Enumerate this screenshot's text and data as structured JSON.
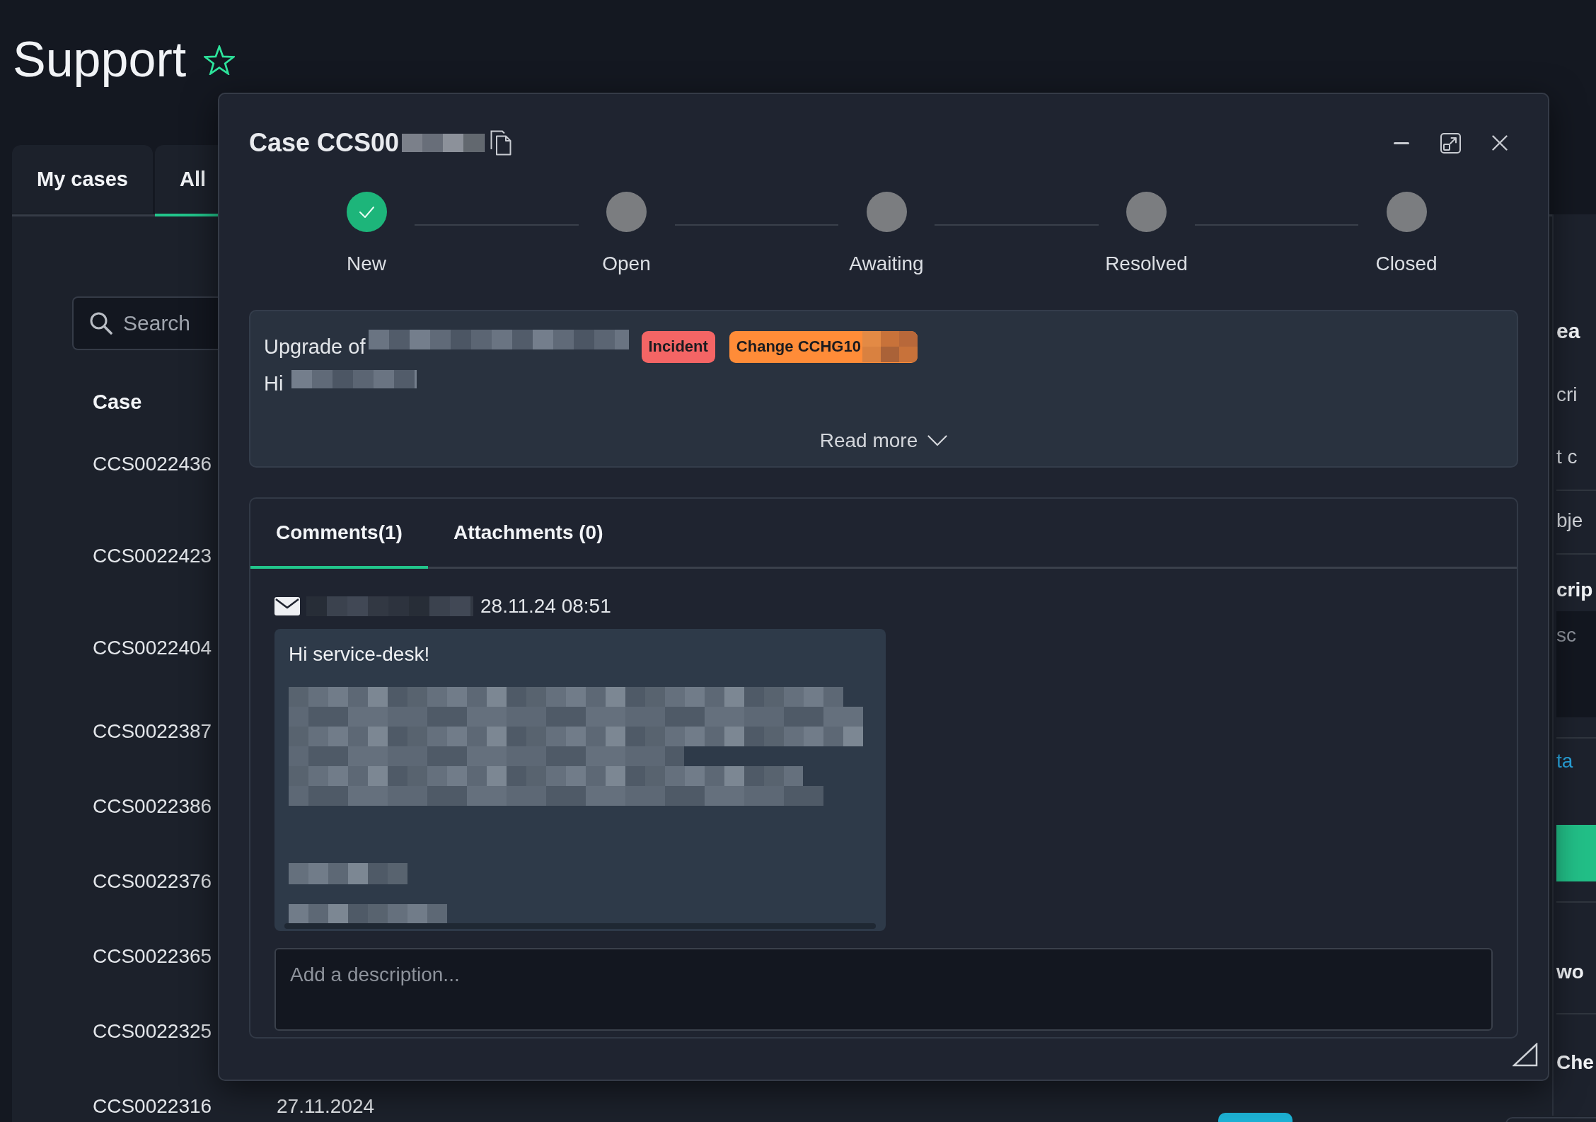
{
  "page": {
    "title": "Support"
  },
  "case_list": {
    "tabs": [
      {
        "label": "My cases",
        "selected": false
      },
      {
        "label": "All",
        "selected": true
      }
    ],
    "search": {
      "placeholder": "Search"
    },
    "columns": [
      "Case"
    ],
    "rows": [
      {
        "case": "CCS0022436"
      },
      {
        "case": "CCS0022423"
      },
      {
        "case": "CCS0022404"
      },
      {
        "case": "CCS0022387"
      },
      {
        "case": "CCS0022386"
      },
      {
        "case": "CCS0022376"
      },
      {
        "case": "CCS0022365"
      },
      {
        "case": "CCS0022325"
      },
      {
        "case": "CCS0022316",
        "column_2": "27.11.2024",
        "badge": {
          "color": "#1db3d6"
        }
      }
    ]
  },
  "details_panel": {
    "sections": [
      {
        "items": [
          {
            "kind": "heading",
            "text": "ea"
          },
          {
            "kind": "text",
            "text": "cri"
          },
          {
            "kind": "text",
            "text": "t c"
          }
        ]
      },
      {
        "items": [
          {
            "kind": "text",
            "text": "bje"
          }
        ]
      },
      {
        "items": [
          {
            "kind": "label",
            "text": "crip"
          },
          {
            "kind": "field",
            "placeholder": "sc"
          }
        ]
      },
      {
        "items": [
          {
            "kind": "link",
            "text": "ta"
          },
          {
            "kind": "button"
          }
        ]
      },
      {
        "items": [
          {
            "kind": "label",
            "text": "wo"
          }
        ]
      },
      {
        "items": [
          {
            "kind": "label",
            "text": "Che"
          }
        ]
      }
    ]
  },
  "case_dialog": {
    "title": "Case CCS00",
    "title_redacted": true,
    "steps": [
      {
        "label": "New",
        "done": true
      },
      {
        "label": "Open",
        "done": false
      },
      {
        "label": "Awaiting",
        "done": false
      },
      {
        "label": "Resolved",
        "done": false
      },
      {
        "label": "Closed",
        "done": false
      }
    ],
    "summary": {
      "title": "Upgrade of",
      "title_redacted": true,
      "tags": [
        {
          "label": "Incident",
          "color": "#f46565",
          "redacted": false
        },
        {
          "label": "Change CCHG10",
          "color": "#ff8c38",
          "redacted": true
        }
      ],
      "body": "Hi",
      "body_redacted": true,
      "read_more": "Read more"
    },
    "tabs": [
      {
        "label": "Comments(1)",
        "selected": true
      },
      {
        "label": "Attachments (0)",
        "selected": false
      }
    ],
    "comments": [
      {
        "author_redacted": true,
        "date": "28.11.24 08:51",
        "text": "Hi service-desk!",
        "body_redacted": true
      }
    ],
    "comment_field": {
      "placeholder": "Add a description..."
    }
  }
}
